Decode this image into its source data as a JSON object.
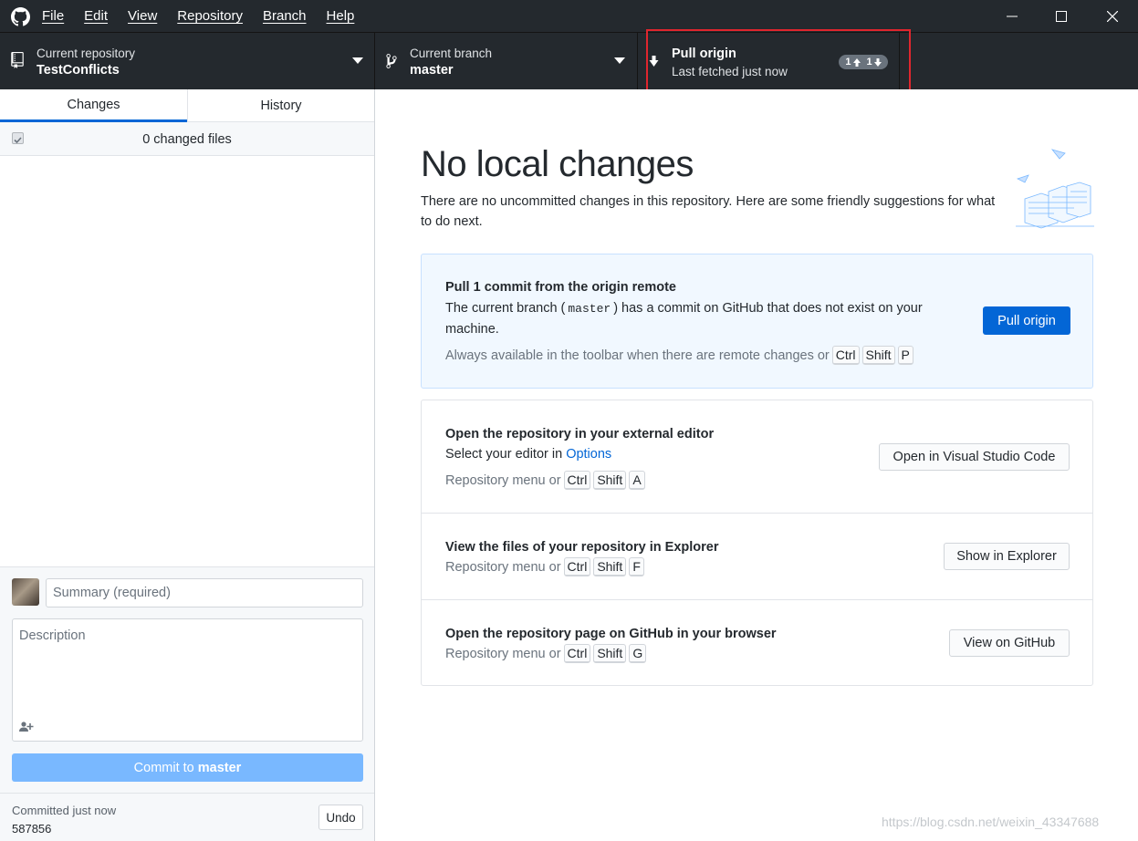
{
  "menu": [
    "File",
    "Edit",
    "View",
    "Repository",
    "Branch",
    "Help"
  ],
  "toolbar": {
    "repo_label": "Current repository",
    "repo_value": "TestConflicts",
    "branch_label": "Current branch",
    "branch_value": "master",
    "pull_title": "Pull origin",
    "pull_sub": "Last fetched just now",
    "ahead": "1",
    "behind": "1"
  },
  "sidebar": {
    "tabs": [
      "Changes",
      "History"
    ],
    "changed_files": "0 changed files",
    "summary_placeholder": "Summary (required)",
    "description_placeholder": "Description",
    "commit_prefix": "Commit to ",
    "commit_branch": "master",
    "last_commit_text": "Committed just now",
    "last_commit_sha": "587856",
    "undo_label": "Undo"
  },
  "main": {
    "title": "No local changes",
    "intro": "There are no uncommitted changes in this repository. Here are some friendly suggestions for what to do next.",
    "pull_card": {
      "title": "Pull 1 commit from the origin remote",
      "text_a": "The current branch (",
      "branch": "master",
      "text_b": ") has a commit on GitHub that does not exist on your",
      "text_c": "machine.",
      "hint": "Always available in the toolbar when there are remote changes or",
      "keys": [
        "Ctrl",
        "Shift",
        "P"
      ],
      "button": "Pull origin"
    },
    "editor_card": {
      "title": "Open the repository in your external editor",
      "text": "Select your editor in",
      "link": "Options",
      "hint": "Repository menu or",
      "keys": [
        "Ctrl",
        "Shift",
        "A"
      ],
      "button": "Open in Visual Studio Code"
    },
    "explorer_card": {
      "title": "View the files of your repository in Explorer",
      "hint": "Repository menu or",
      "keys": [
        "Ctrl",
        "Shift",
        "F"
      ],
      "button": "Show in Explorer"
    },
    "github_card": {
      "title": "Open the repository page on GitHub in your browser",
      "hint": "Repository menu or",
      "keys": [
        "Ctrl",
        "Shift",
        "G"
      ],
      "button": "View on GitHub"
    }
  },
  "watermark": "https://blog.csdn.net/weixin_43347688",
  "colors": {
    "accent": "#0366d6",
    "toolbar": "#24292e",
    "highlight": "#e0262e",
    "callout_bg": "#f1f8ff"
  }
}
